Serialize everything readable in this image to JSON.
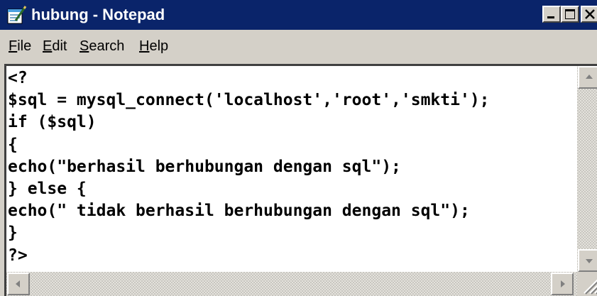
{
  "window": {
    "title": "hubung - Notepad",
    "icon": "notepad-icon",
    "controls": {
      "minimize_icon": "minimize-icon",
      "maximize_icon": "maximize-icon",
      "close_icon": "close-icon"
    }
  },
  "menu": {
    "items": [
      {
        "accel": "F",
        "rest": "ile"
      },
      {
        "accel": "E",
        "rest": "dit"
      },
      {
        "accel": "S",
        "rest": "earch"
      },
      {
        "accel": "H",
        "rest": "elp"
      }
    ]
  },
  "editor": {
    "content": "<?\n$sql = mysql_connect('localhost','root','smkti');\nif ($sql)\n{\necho(\"berhasil berhubungan dengan sql\");\n} else {\necho(\" tidak berhasil berhubungan dengan sql\");\n}\n?>"
  },
  "scrollbars": {
    "up_icon": "arrow-up-icon",
    "down_icon": "arrow-down-icon",
    "left_icon": "arrow-left-icon",
    "right_icon": "arrow-right-icon",
    "grip_icon": "size-grip-icon"
  },
  "colors": {
    "titlebar": "#0a246a",
    "chrome": "#d4d0c8",
    "text_bg": "#ffffff"
  }
}
